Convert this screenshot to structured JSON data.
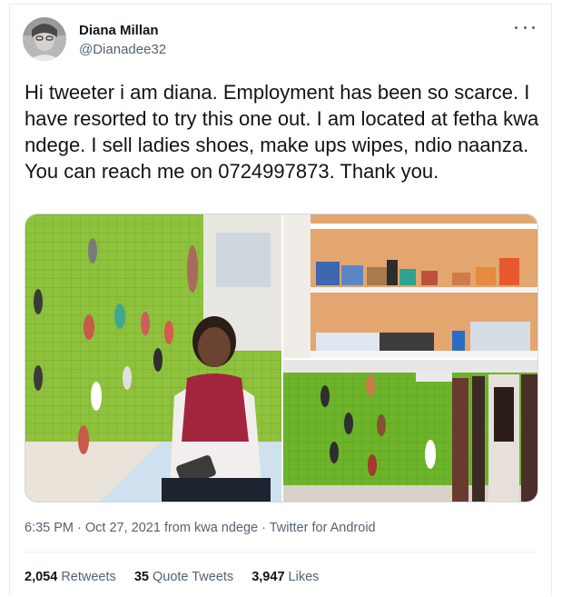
{
  "author": {
    "name": "Diana Millan",
    "handle": "@Dianadee32"
  },
  "tweet": {
    "text": "Hi tweeter i am diana. Employment has been so scarce. I have resorted to try this one out. I am located at fetha kwa ndege. I sell ladies shoes, make ups wipes, ndio naanza. You can reach me on 0724997873. Thank you."
  },
  "meta": {
    "time": "6:35 PM",
    "sep1": " · ",
    "date": "Oct 27, 2021",
    "from_prefix": " from ",
    "location": "kwa ndege",
    "sep2": " · ",
    "source": "Twitter for Android"
  },
  "stats": {
    "retweets_count": "2,054",
    "retweets_label": "Retweets",
    "quotes_count": "35",
    "quotes_label": "Quote Tweets",
    "likes_count": "3,947",
    "likes_label": "Likes"
  },
  "icons": {
    "more": "more-horizontal-icon"
  },
  "colors": {
    "text": "#0f1419",
    "secondary": "#536471",
    "border": "#cfd9de"
  }
}
